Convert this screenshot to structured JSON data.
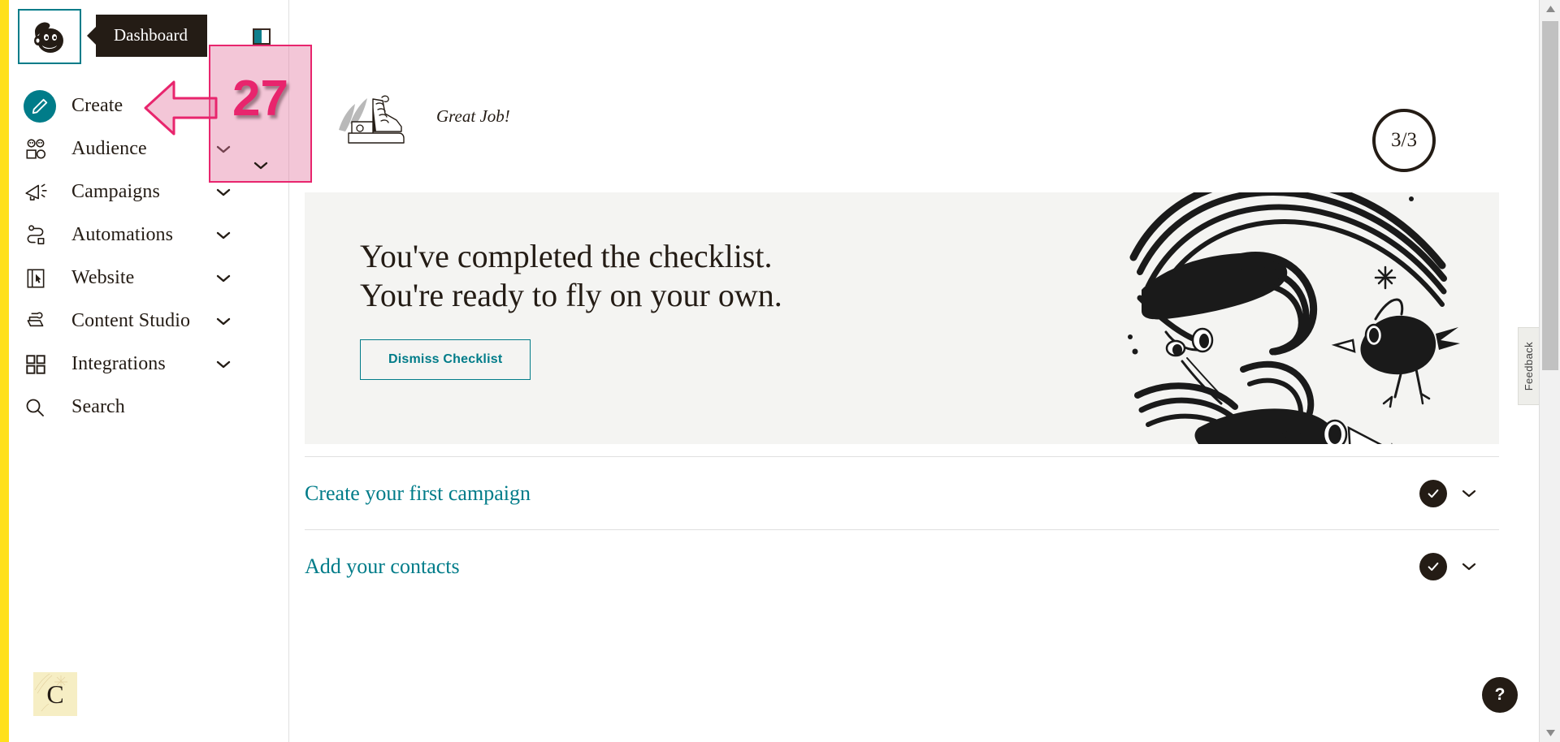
{
  "app": {
    "name": "Mailchimp Dashboard",
    "brand_yellow": "#ffe01b",
    "brand_teal": "#007c89",
    "ink": "#241c15"
  },
  "sidebar": {
    "logo_name": "mailchimp-freddie-logo",
    "tooltip": "Dashboard",
    "items": [
      {
        "label": "Create",
        "icon": "pencil-icon",
        "has_chevron": false,
        "highlight": true
      },
      {
        "label": "Audience",
        "icon": "audience-icon",
        "has_chevron": true,
        "highlight": false
      },
      {
        "label": "Campaigns",
        "icon": "megaphone-icon",
        "has_chevron": true,
        "highlight": false
      },
      {
        "label": "Automations",
        "icon": "automations-icon",
        "has_chevron": true,
        "highlight": false
      },
      {
        "label": "Website",
        "icon": "website-icon",
        "has_chevron": true,
        "highlight": false
      },
      {
        "label": "Content Studio",
        "icon": "content-studio-icon",
        "has_chevron": true,
        "highlight": false
      },
      {
        "label": "Integrations",
        "icon": "integrations-icon",
        "has_chevron": true,
        "highlight": false
      },
      {
        "label": "Search",
        "icon": "search-icon",
        "has_chevron": false,
        "highlight": false
      }
    ],
    "avatar_letter": "C"
  },
  "main": {
    "greeting": "Great Job!",
    "progress": "3/3",
    "hero": {
      "line1": "You've completed the checklist.",
      "line2": "You're ready to fly on your own.",
      "dismiss_label": "Dismiss Checklist",
      "art_name": "birds-flying-illustration"
    },
    "checklist": [
      {
        "title": "Create your first campaign",
        "state": "complete"
      },
      {
        "title": "Add your contacts",
        "state": "complete"
      }
    ]
  },
  "overlays": {
    "feedback_label": "Feedback",
    "help_label": "?",
    "annotation": {
      "number": "27",
      "color": "#e8256d",
      "fill": "rgba(226,120,160,0.42)"
    }
  },
  "scrollbar": {
    "up_arrow": "▲",
    "down_arrow": "▼"
  }
}
